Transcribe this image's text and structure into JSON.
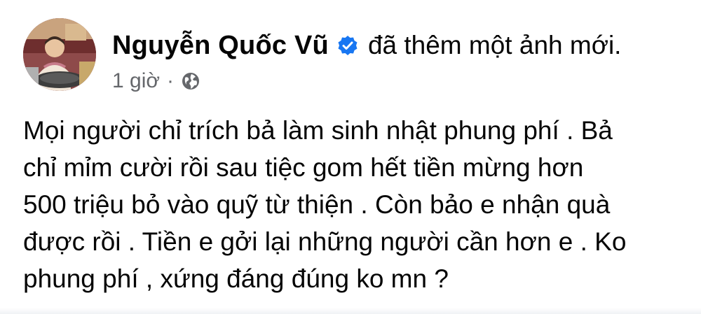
{
  "post": {
    "author_name": "Nguyễn Quốc Vũ",
    "verified_icon": "verified-badge-icon",
    "action_text": "đã thêm một ảnh mới.",
    "timestamp": "1 giờ",
    "separator": "·",
    "privacy_icon": "globe-icon",
    "text_lines": [
      "Mọi người chỉ trích bả làm sinh nhật phung phí . Bả",
      "chỉ mỉm cười rồi sau tiệc gom hết tiền mừng hơn",
      "500 triệu bỏ vào quỹ từ thiện . Còn bảo e nhận quà",
      "được rồi . Tiền e gởi lại những người cần hơn e . Ko",
      "phung phí , xứng đáng đúng ko mn ?"
    ]
  },
  "colors": {
    "verified_blue": "#1877f2",
    "meta_gray": "#65676b",
    "text": "#050505"
  }
}
